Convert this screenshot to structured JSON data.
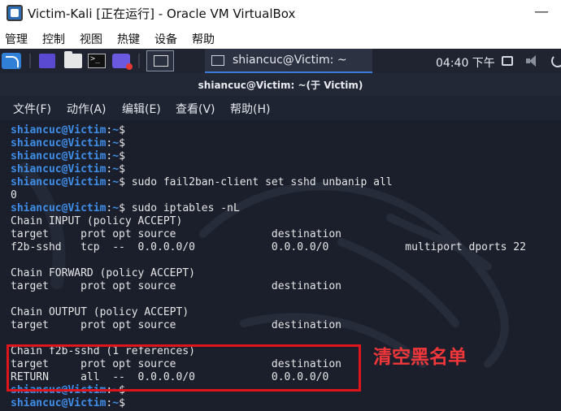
{
  "vbox": {
    "title": "Victim-Kali [正在运行] - Oracle VM VirtualBox",
    "minimize_symbol": "—",
    "menu": [
      "管理",
      "控制",
      "视图",
      "热键",
      "设备",
      "帮助"
    ]
  },
  "panel": {
    "task_label": "shiancuc@Victim: ~",
    "clock": "04:40 下午",
    "icons": [
      "kali-logo-icon",
      "desktop-icon",
      "file-manager-icon",
      "terminal-icon",
      "screen-recorder-icon",
      "workspace-switcher-icon",
      "display-icon",
      "volume-icon",
      "power-icon"
    ]
  },
  "terminal": {
    "title": "shiancuc@Victim: ~(于 Victim)",
    "menu": [
      "文件(F)",
      "动作(A)",
      "编辑(E)",
      "查看(V)",
      "帮助(H)"
    ],
    "prompt": {
      "user": "shiancuc@Victim",
      "colon": ":",
      "path": "~",
      "sign": "$"
    },
    "lines": [
      {
        "type": "prompt",
        "cmd": ""
      },
      {
        "type": "prompt",
        "cmd": ""
      },
      {
        "type": "prompt",
        "cmd": ""
      },
      {
        "type": "prompt",
        "cmd": ""
      },
      {
        "type": "prompt",
        "cmd": " sudo fail2ban-client set sshd unbanip all"
      },
      {
        "type": "out",
        "text": "0"
      },
      {
        "type": "prompt",
        "cmd": " sudo iptables -nL"
      },
      {
        "type": "out",
        "text": "Chain INPUT (policy ACCEPT)"
      },
      {
        "type": "out",
        "text": "target     prot opt source               destination"
      },
      {
        "type": "out",
        "text": "f2b-sshd   tcp  --  0.0.0.0/0            0.0.0.0/0            multiport dports 22"
      },
      {
        "type": "out",
        "text": ""
      },
      {
        "type": "out",
        "text": "Chain FORWARD (policy ACCEPT)"
      },
      {
        "type": "out",
        "text": "target     prot opt source               destination"
      },
      {
        "type": "out",
        "text": ""
      },
      {
        "type": "out",
        "text": "Chain OUTPUT (policy ACCEPT)"
      },
      {
        "type": "out",
        "text": "target     prot opt source               destination"
      },
      {
        "type": "out",
        "text": ""
      },
      {
        "type": "out",
        "text": "Chain f2b-sshd (1 references)"
      },
      {
        "type": "out",
        "text": "target     prot opt source               destination"
      },
      {
        "type": "out",
        "text": "RETURN     all  --  0.0.0.0/0            0.0.0.0/0"
      },
      {
        "type": "prompt",
        "cmd": ""
      },
      {
        "type": "prompt",
        "cmd": ""
      }
    ]
  },
  "annotation": {
    "text": "清空黑名单",
    "color": "#e0151b"
  }
}
